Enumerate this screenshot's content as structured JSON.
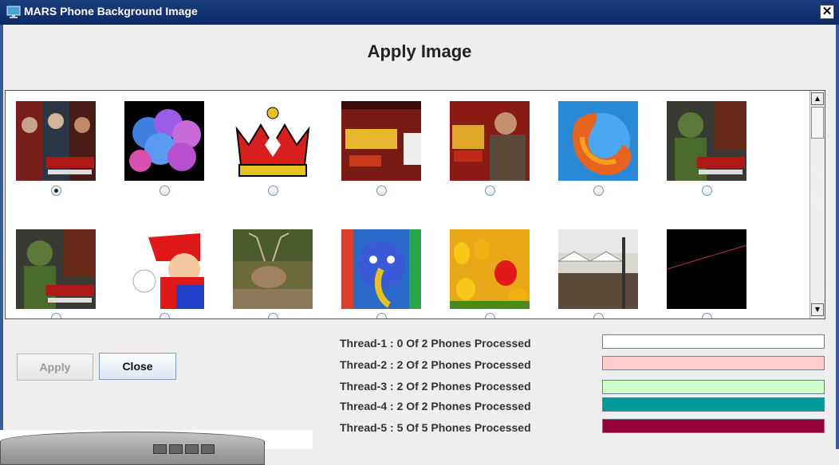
{
  "window": {
    "title": "MARS Phone Background Image",
    "close_glyph": "✕"
  },
  "heading": "Apply Image",
  "gallery": {
    "selected_index": 0,
    "row1": [
      {
        "name": "avengers-image",
        "selected": true
      },
      {
        "name": "balloons-image",
        "selected": false
      },
      {
        "name": "crown-image",
        "selected": false
      },
      {
        "name": "emotional-atyachaar-image",
        "selected": false
      },
      {
        "name": "emotional-atyachaar-man-image",
        "selected": false
      },
      {
        "name": "firefox-image",
        "selected": false
      },
      {
        "name": "avengers-hulk-image",
        "selected": false
      }
    ],
    "row2": [
      {
        "name": "avengers-hulk-image-2",
        "selected": false
      },
      {
        "name": "mario-image",
        "selected": false
      },
      {
        "name": "deer-image",
        "selected": false
      },
      {
        "name": "ganesha-image",
        "selected": false
      },
      {
        "name": "tulips-image",
        "selected": false
      },
      {
        "name": "street-cafe-image",
        "selected": false
      },
      {
        "name": "black-image",
        "selected": false
      }
    ]
  },
  "buttons": {
    "apply": "Apply",
    "close": "Close"
  },
  "threads": [
    {
      "label": "Thread-1 : 0 Of 2 Phones Processed",
      "color": "#ffffff",
      "progress": 0
    },
    {
      "label": "Thread-2 : 2 Of 2 Phones Processed",
      "color": "#ffcccc",
      "progress": 1
    },
    {
      "label": "Thread-3 : 2 Of 2 Phones Processed",
      "color": "#ccffcc",
      "progress": 1
    },
    {
      "label": "Thread-4 : 2 Of 2 Phones Processed",
      "color": "#009999",
      "progress": 1
    },
    {
      "label": "Thread-5 : 5 Of 5 Phones Processed",
      "color": "#99003a",
      "progress": 1
    }
  ],
  "colors": {
    "titlebar": "#0c2a66",
    "frame": "#3a5c96",
    "background": "#eeeeee"
  }
}
